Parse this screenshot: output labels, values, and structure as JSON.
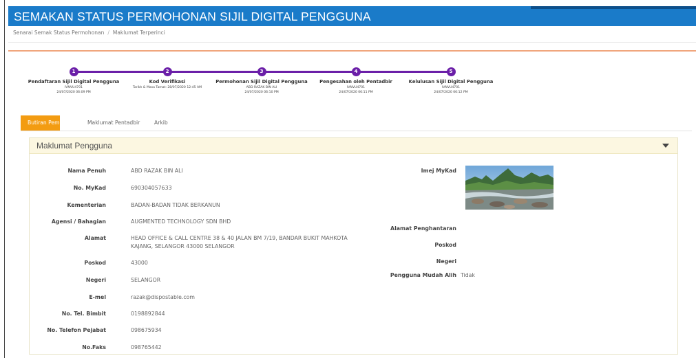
{
  "header": {
    "title": "SEMAKAN STATUS PERMOHONAN SIJIL DIGITAL PENGGUNA"
  },
  "breadcrumb": {
    "items": [
      "Senarai Semak Status Permohonan",
      "Maklumat Terperinci"
    ],
    "separator": "/"
  },
  "steps": [
    {
      "number": "1",
      "label": "Pendaftaran Sijil Digital Pengguna",
      "lines": [
        "IVNVU4701",
        "24/07/2020 06:09 PM"
      ]
    },
    {
      "number": "2",
      "label": "Kod Verifikasi",
      "lines": [
        "Tarikh & Masa Tamat: 28/07/2020 12:45 AM"
      ]
    },
    {
      "number": "3",
      "label": "Permohonan Sijil Digital Pengguna",
      "lines": [
        "ABD RAZAK BIN ALI",
        "24/07/2020 06:10 PM"
      ]
    },
    {
      "number": "4",
      "label": "Pengesahan oleh Pentadbir",
      "lines": [
        "IVNVU4701",
        "24/07/2020 06:11 PM"
      ]
    },
    {
      "number": "5",
      "label": "Kelulusan Sijil Digital Pengguna",
      "lines": [
        "IVNVU4701",
        "24/07/2020 06:12 PM"
      ]
    }
  ],
  "tabs": [
    "Butiran Pemohon",
    "Maklumat Pentadbir",
    "Arkib"
  ],
  "panel": {
    "title": "Maklumat Pengguna",
    "left_fields": [
      {
        "label": "Nama Penuh",
        "value": "ABD RAZAK BIN ALI"
      },
      {
        "label": "No. MyKad",
        "value": "690304057633"
      },
      {
        "label": "Kementerian",
        "value": "BADAN-BADAN TIDAK BERKANUN"
      },
      {
        "label": "Agensi / Bahagian",
        "value": "AUGMENTED TECHNOLOGY SDN BHD"
      },
      {
        "label": "Alamat",
        "value_lines": [
          "HEAD OFFICE & CALL CENTRE 38 & 40 JALAN BM 7/19, BANDAR BUKIT MAHKOTA",
          "KAJANG, SELANGOR 43000 SELANGOR"
        ]
      },
      {
        "label": "Poskod",
        "value": "43000"
      },
      {
        "label": "Negeri",
        "value": "SELANGOR"
      },
      {
        "label": "E-mel",
        "value": "razak@dispostable.com"
      },
      {
        "label": "No. Tel. Bimbit",
        "value": "0198892844"
      },
      {
        "label": "No. Telefon Pejabat",
        "value": "098675934"
      },
      {
        "label": "No.Faks",
        "value": "098765442"
      }
    ],
    "right_fields": [
      {
        "label": "Imej MyKad",
        "value": ""
      },
      {
        "label": "Alamat Penghantaran",
        "value": ""
      },
      {
        "label": "Poskod",
        "value": ""
      },
      {
        "label": "Negeri",
        "value": ""
      },
      {
        "label": "Pengguna Mudah Alih",
        "value": "Tidak"
      }
    ]
  },
  "colors": {
    "header": "#1a7bc9",
    "stepper": "#6b1fa8",
    "active_tab": "#f39c12",
    "accent_rule": "#f0a57c",
    "panel_header": "#fcf7e1"
  }
}
